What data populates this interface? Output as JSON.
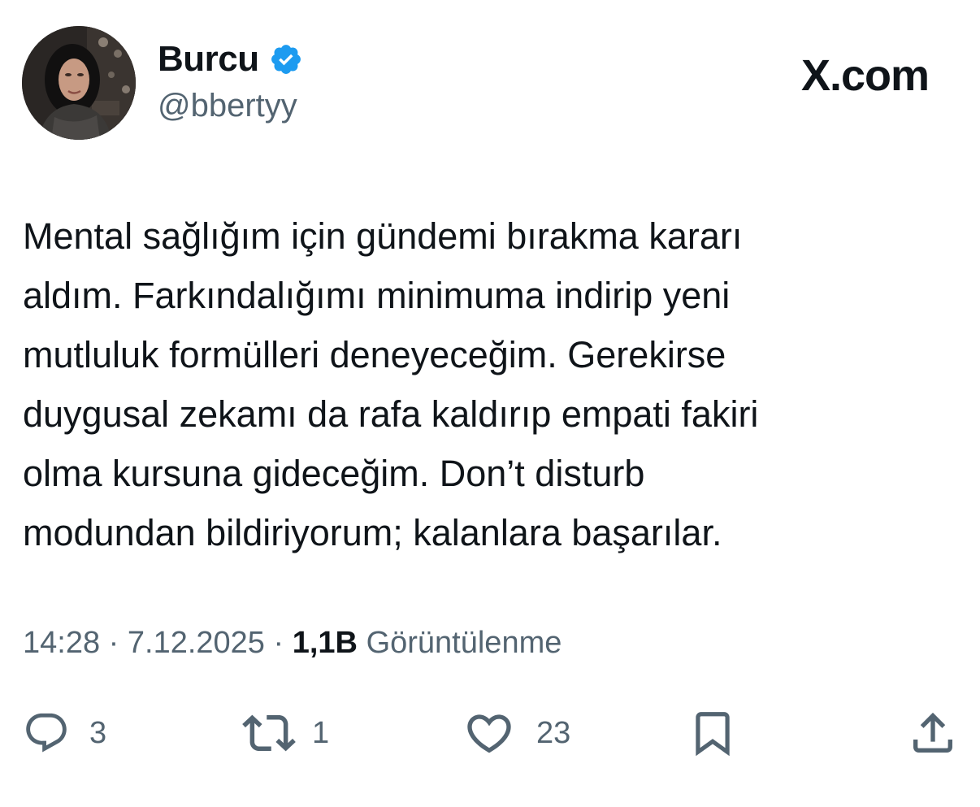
{
  "header": {
    "display_name": "Burcu",
    "handle": "@bbertyy",
    "brand": "X.com",
    "verified_icon": "verified-badge-icon",
    "accent_color": "#1d9bf0"
  },
  "tweet": {
    "text": "Mental sağlığım için gündemi bırakma kararı\naldım. Farkındalığımı minimuma indirip yeni\nmutluluk formülleri deneyeceğim. Gerekirse\nduygusal zekamı da rafa kaldırıp empati fakiri\nolma kursuna gideceğim. Don’t disturb\nmodundan bildiriyorum; kalanlara başarılar."
  },
  "meta": {
    "time": "14:28",
    "separator": "·",
    "date": "7.12.2025",
    "views_count": "1,1B",
    "views_label": "Görüntülenme"
  },
  "actions": {
    "replies": "3",
    "reposts": "1",
    "likes": "23",
    "icons": [
      "reply-icon",
      "repost-icon",
      "like-icon",
      "bookmark-icon",
      "share-icon"
    ]
  },
  "colors": {
    "text_primary": "#0f1419",
    "text_secondary": "#536471"
  }
}
